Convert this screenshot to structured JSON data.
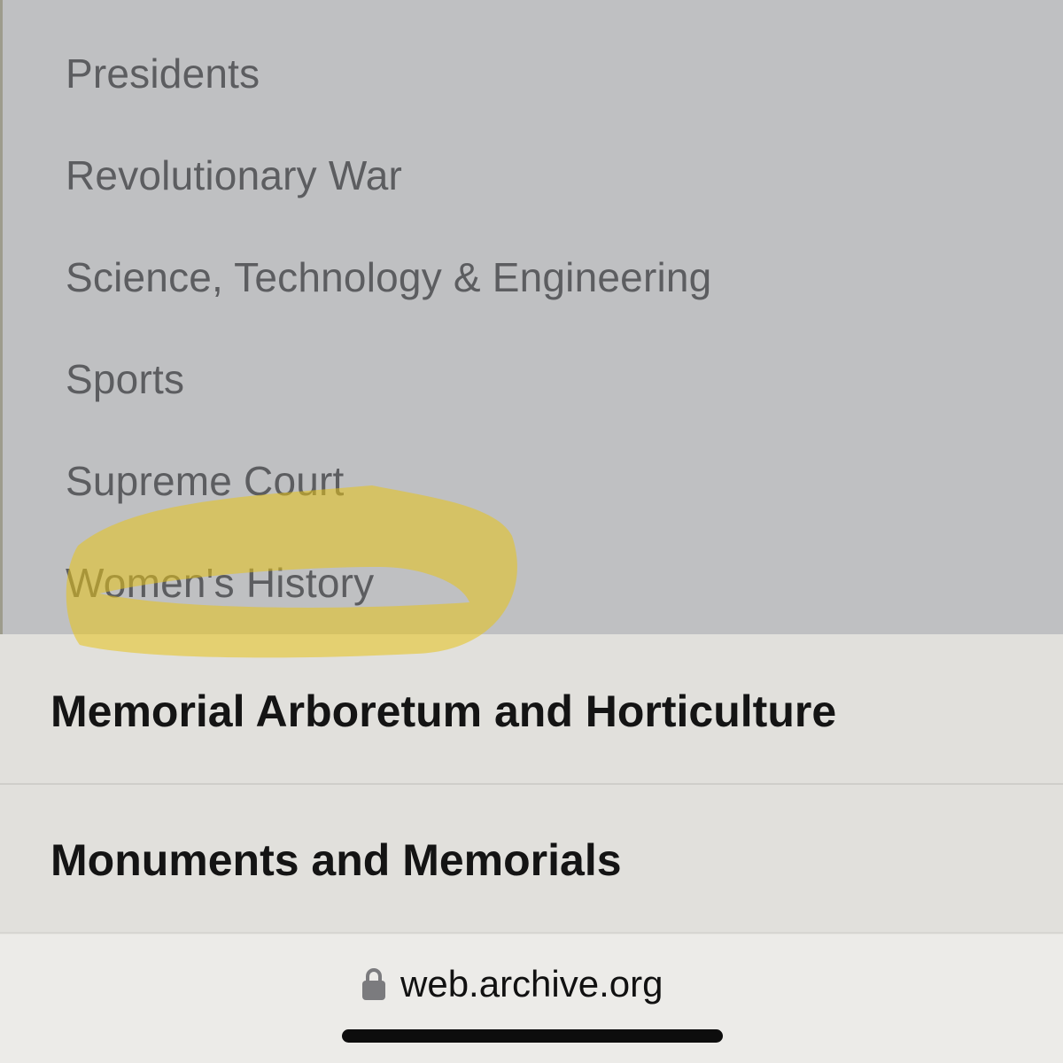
{
  "submenu": {
    "items": [
      {
        "label": "Presidents"
      },
      {
        "label": "Revolutionary War"
      },
      {
        "label": "Science, Technology & Engineering"
      },
      {
        "label": "Sports"
      },
      {
        "label": "Supreme Court"
      },
      {
        "label": "Women's History"
      }
    ]
  },
  "nav": {
    "items": [
      {
        "label": "Memorial Arboretum and Horticulture"
      },
      {
        "label": "Monuments and Memorials"
      }
    ]
  },
  "browser": {
    "url": "web.archive.org",
    "lock_icon": "lock-icon"
  },
  "annotation": {
    "color": "#e8c21a",
    "target": "Women's History"
  },
  "colors": {
    "submenu_bg": "#bfc0c2",
    "submenu_text": "#5c5d60",
    "nav_bg": "#e1e0dc",
    "nav_text": "#141414"
  }
}
